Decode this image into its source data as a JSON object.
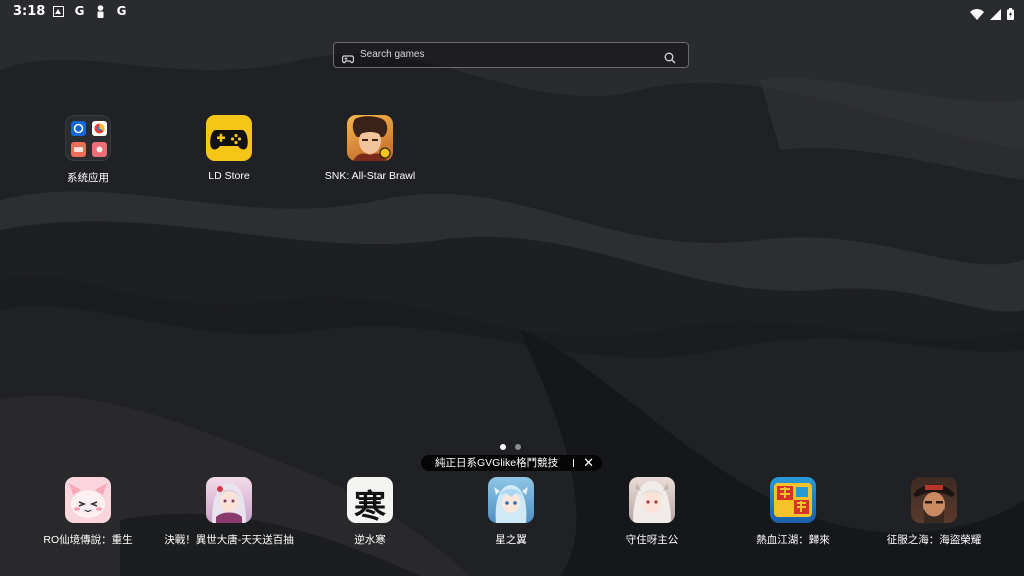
{
  "status": {
    "time": "3:18",
    "left_icons": [
      {
        "name": "screenshot-icon",
        "glyph": "▣"
      },
      {
        "name": "google-icon",
        "glyph": "G"
      },
      {
        "name": "person-icon",
        "glyph": "♟"
      },
      {
        "name": "google-icon-2",
        "glyph": "G"
      }
    ]
  },
  "search": {
    "placeholder": "Search games"
  },
  "apps": [
    {
      "label": "系统应用"
    },
    {
      "label": "LD Store"
    },
    {
      "label": "SNK: All-Star Brawl"
    }
  ],
  "dock": [
    {
      "label": "RO仙境傳說：重生"
    },
    {
      "label": "決戰！異世大唐-天天送百抽"
    },
    {
      "label": "逆水寒"
    },
    {
      "label": "星之翼"
    },
    {
      "label": "守住呀主公"
    },
    {
      "label": "熱血江湖：歸來"
    },
    {
      "label": "征服之海：海盜榮耀"
    }
  ],
  "dock_glyphs": {
    "nishuihan": "寒"
  },
  "banner": {
    "text": "純正日系GVGlike格鬥競技",
    "close": "✕"
  },
  "colors": {
    "accent": "#f5c518",
    "background": "#1f2022"
  }
}
